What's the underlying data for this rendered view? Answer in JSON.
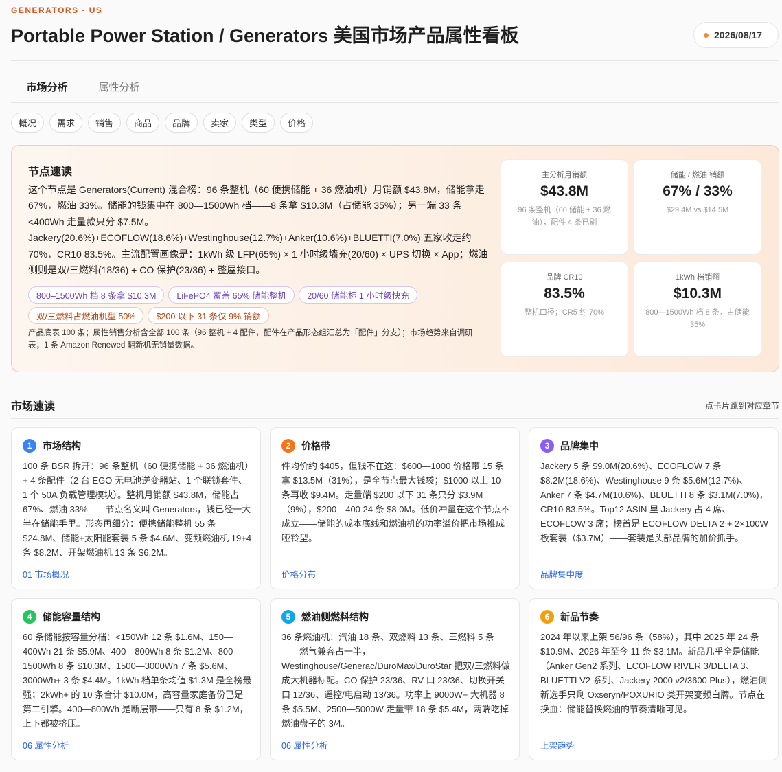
{
  "header": {
    "eyebrow": "GENERATORS · US",
    "title": "Portable Power Station / Generators 美国市场产品属性看板",
    "date": "2026/08/17"
  },
  "tabs": [
    {
      "label": "市场分析",
      "active": true
    },
    {
      "label": "属性分析",
      "active": false
    }
  ],
  "chips": [
    "概况",
    "需求",
    "销售",
    "商品",
    "品牌",
    "卖家",
    "类型",
    "价格"
  ],
  "summary": {
    "title": "节点速读",
    "body": "这个节点是 Generators(Current) 混合榜：96 条整机（60 便携储能 + 36 燃油机）月销额 $43.8M，储能拿走 67%，燃油 33%。储能的钱集中在 800—1500Wh 档——8 条拿 $10.3M（占储能 35%）；另一端 33 条 <400Wh 走量款只分 $7.5M。Jackery(20.6%)+ECOFLOW(18.6%)+Westinghouse(12.7%)+Anker(10.6%)+BLUETTI(7.0%) 五家收走约 70%，CR10 83.5%。主流配置画像是：1kWh 级 LFP(65%) × 1 小时级墙充(20/60) × UPS 切换 × App；燃油侧则是双/三燃料(18/36) + CO 保护(23/36) + 整屋接口。",
    "tags": [
      {
        "label": "800–1500Wh 档 8 条拿 $10.3M",
        "tone": "purple"
      },
      {
        "label": "LiFePO4 覆盖 65% 储能整机",
        "tone": "purple"
      },
      {
        "label": "20/60 储能标 1 小时级快充",
        "tone": "purple"
      },
      {
        "label": "双/三燃料占燃油机型 50%",
        "tone": "orange"
      },
      {
        "label": "$200 以下 31 条仅 9% 销额",
        "tone": "orange"
      }
    ],
    "note": "产品底表 100 条；属性销售分析含全部 100 条（96 整机 + 4 配件，配件在产品形态组汇总为「配件」分支）；市场趋势来自调研表；1 条 Amazon Renewed 翻新机无销量数据。"
  },
  "metrics": [
    {
      "label": "主分析月销额",
      "value": "$43.8M",
      "note": "96 条整机（60 储能 + 36 燃油），配件 4 条已剔"
    },
    {
      "label": "储能 / 燃油 销额",
      "value": "67% / 33%",
      "note": "$29.4M vs $14.5M"
    },
    {
      "label": "品牌 CR10",
      "value": "83.5%",
      "note": "整机口径；CR5 约 70%"
    },
    {
      "label": "1kWh 档销额",
      "value": "$10.3M",
      "note": "800—1500Wh 档 8 条，占储能 35%"
    }
  ],
  "quick": {
    "title": "市场速读",
    "hint": "点卡片跳到对应章节",
    "cards": [
      {
        "num": "1",
        "color": "#3b82f6",
        "title": "市场结构",
        "body": "100 条 BSR 拆开：96 条整机（60 便携储能 + 36 燃油机）+ 4 条配件（2 台 EGO 无电池逆变器站、1 个联锁套件、1 个 50A 负载管理模块）。整机月销额 $43.8M，储能占 67%、燃油 33%——节点名义叫 Generators，钱已经一大半在储能手里。形态再细分：便携储能整机 55 条 $24.8M、储能+太阳能套装 5 条 $4.6M、变频燃油机 19+4 条 $8.2M、开架燃油机 13 条 $6.2M。",
        "link": "01 市场概况"
      },
      {
        "num": "2",
        "color": "#f97316",
        "title": "价格带",
        "body": "件均价约 $405，但钱不在这：$600—1000 价格带 15 条拿 $13.5M（31%），是全节点最大钱袋；$1000 以上 10 条再收 $9.4M。走量端 $200 以下 31 条只分 $3.9M（9%），$200—400 24 条 $8.0M。低价冲量在这个节点不成立——储能的成本底线和燃油机的功率溢价把市场推成哑铃型。",
        "link": "价格分布"
      },
      {
        "num": "3",
        "color": "#8b5cf6",
        "title": "品牌集中",
        "body": "Jackery 5 条 $9.0M(20.6%)、ECOFLOW 7 条 $8.2M(18.6%)、Westinghouse 9 条 $5.6M(12.7%)、Anker 7 条 $4.7M(10.6%)、BLUETTI 8 条 $3.1M(7.0%)，CR10 83.5%。Top12 ASIN 里 Jackery 占 4 席、ECOFLOW 3 席；榜首是 ECOFLOW DELTA 2 + 2×100W 板套装（$3.7M）——套装是头部品牌的加价抓手。",
        "link": "品牌集中度"
      },
      {
        "num": "4",
        "color": "#22c55e",
        "title": "储能容量结构",
        "body": "60 条储能按容量分档：<150Wh 12 条 $1.6M、150—400Wh 21 条 $5.9M、400—800Wh 8 条 $1.2M、800—1500Wh 8 条 $10.3M、1500—3000Wh 7 条 $5.6M、3000Wh+ 3 条 $4.4M。1kWh 档单条均值 $1.3M 是全榜最强；2kWh+ 的 10 条合计 $10.0M，高容量家庭备份已是第二引擎。400—800Wh 是断层带——只有 8 条 $1.2M，上下都被挤压。",
        "link": "06 属性分析"
      },
      {
        "num": "5",
        "color": "#0ea5e9",
        "title": "燃油侧燃料结构",
        "body": "36 条燃油机：汽油 18 条、双燃料 13 条、三燃料 5 条——燃气兼容占一半，Westinghouse/Generac/DuroMax/DuroStar 把双/三燃料做成大机器标配。CO 保护 23/36、RV 口 23/36、切换开关口 12/36、遥控/电启动 13/36。功率上 9000W+ 大机器 8 条 $5.5M、2500—5000W 走量带 18 条 $5.4M，两端吃掉燃油盘子的 3/4。",
        "link": "06 属性分析"
      },
      {
        "num": "6",
        "color": "#f59e0b",
        "title": "新品节奏",
        "body": "2024 年以来上架 56/96 条（58%），其中 2025 年 24 条 $10.9M、2026 年至今 11 条 $3.1M。新品几乎全是储能（Anker Gen2 系列、ECOFLOW RIVER 3/DELTA 3、BLUETTI V2 系列、Jackery 2000 v2/3600 Plus），燃油侧新选手只剩 Oxseryn/POXURIO 类开架变频白牌。节点在换血：储能替换燃油的节奏清晰可见。",
        "link": "上架趋势"
      }
    ]
  }
}
